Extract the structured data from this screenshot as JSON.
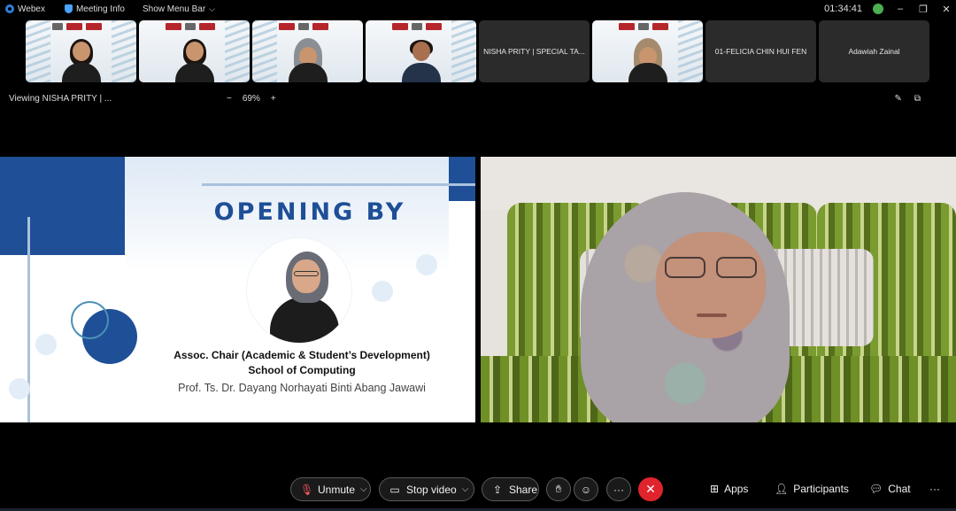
{
  "titlebar": {
    "app_name": "Webex",
    "meeting_info": "Meeting Info",
    "show_menu_bar": "Show Menu Bar",
    "clock": "01:34:41",
    "minimize": "–",
    "restore": "❐",
    "close": "✕"
  },
  "thumbnails": [
    {
      "type": "video",
      "label": ""
    },
    {
      "type": "video",
      "label": ""
    },
    {
      "type": "video",
      "label": ""
    },
    {
      "type": "video",
      "label": ""
    },
    {
      "type": "name",
      "label": "NISHA PRITY | SPECIAL TA..."
    },
    {
      "type": "video",
      "label": ""
    },
    {
      "type": "name",
      "label": "01-FELICIA CHIN HUI FEN"
    },
    {
      "type": "name",
      "label": "Adawiah Zainal"
    }
  ],
  "viewbar": {
    "viewing_label": "Viewing NISHA PRITY | ...",
    "zoom_out": "−",
    "zoom_level": "69%",
    "zoom_in": "+"
  },
  "slide": {
    "title": "OPENING BY",
    "role_line1": "Assoc. Chair (Academic & Student’s Development)",
    "role_line2": "School of Computing",
    "speaker": "Prof. Ts. Dr. Dayang Norhayati Binti Abang Jawawi"
  },
  "controls": {
    "unmute": "Unmute",
    "stop_video": "Stop video",
    "share": "Share",
    "more": "···",
    "apps": "Apps",
    "participants": "Participants",
    "chat": "Chat",
    "overflow": "···"
  },
  "colors": {
    "accent_blue": "#1e4f97",
    "end_red": "#e0242c",
    "muted_red": "#ff5a5a"
  }
}
